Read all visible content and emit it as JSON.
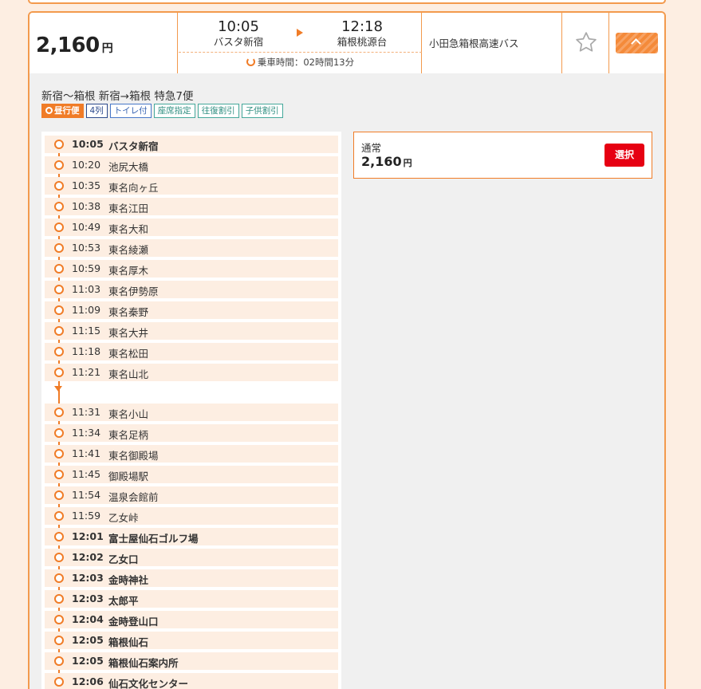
{
  "summary": {
    "price": "2,160",
    "price_unit": "円",
    "departure": {
      "time": "10:05",
      "stop": "バスタ新宿"
    },
    "arrival": {
      "time": "12:18",
      "stop": "箱根桃源台"
    },
    "duration": "乗車時間：02時間13分",
    "company": "小田急箱根高速バス"
  },
  "route_title": "新宿〜箱根 新宿→箱根 特急7便",
  "tags": [
    {
      "label": "昼行便",
      "style": "day"
    },
    {
      "label": "4列",
      "style": "navy"
    },
    {
      "label": "トイレ付",
      "style": "blue"
    },
    {
      "label": "座席指定",
      "style": "teal"
    },
    {
      "label": "往復割引",
      "style": "teal"
    },
    {
      "label": "子供割引",
      "style": "teal"
    }
  ],
  "stops": [
    {
      "time": "10:05",
      "name": "バスタ新宿",
      "bold": true
    },
    {
      "time": "10:20",
      "name": "池尻大橋",
      "bold": false
    },
    {
      "time": "10:35",
      "name": "東名向ヶ丘",
      "bold": false
    },
    {
      "time": "10:38",
      "name": "東名江田",
      "bold": false
    },
    {
      "time": "10:49",
      "name": "東名大和",
      "bold": false
    },
    {
      "time": "10:53",
      "name": "東名綾瀬",
      "bold": false
    },
    {
      "time": "10:59",
      "name": "東名厚木",
      "bold": false
    },
    {
      "time": "11:03",
      "name": "東名伊勢原",
      "bold": false
    },
    {
      "time": "11:09",
      "name": "東名秦野",
      "bold": false
    },
    {
      "time": "11:15",
      "name": "東名大井",
      "bold": false
    },
    {
      "time": "11:18",
      "name": "東名松田",
      "bold": false
    },
    {
      "time": "11:21",
      "name": "東名山北",
      "bold": false
    },
    {
      "time": "11:31",
      "name": "東名小山",
      "bold": false
    },
    {
      "time": "11:34",
      "name": "東名足柄",
      "bold": false
    },
    {
      "time": "11:41",
      "name": "東名御殿場",
      "bold": false
    },
    {
      "time": "11:45",
      "name": "御殿場駅",
      "bold": false
    },
    {
      "time": "11:54",
      "name": "温泉会館前",
      "bold": false
    },
    {
      "time": "11:59",
      "name": "乙女峠",
      "bold": false
    },
    {
      "time": "12:01",
      "name": "富士屋仙石ゴルフ場",
      "bold": true
    },
    {
      "time": "12:02",
      "name": "乙女口",
      "bold": true
    },
    {
      "time": "12:03",
      "name": "金時神社",
      "bold": true
    },
    {
      "time": "12:03",
      "name": "太郎平",
      "bold": true
    },
    {
      "time": "12:04",
      "name": "金時登山口",
      "bold": true
    },
    {
      "time": "12:05",
      "name": "箱根仙石",
      "bold": true
    },
    {
      "time": "12:05",
      "name": "箱根仙石案内所",
      "bold": true
    },
    {
      "time": "12:06",
      "name": "仙石文化センター",
      "bold": true
    }
  ],
  "fare": {
    "label": "通常",
    "price": "2,160",
    "unit": "円",
    "select_label": "選択"
  },
  "colors": {
    "accent": "#f07c27",
    "border": "#f39a4d",
    "select": "#e60012",
    "row_bg": "#fdeee2"
  }
}
